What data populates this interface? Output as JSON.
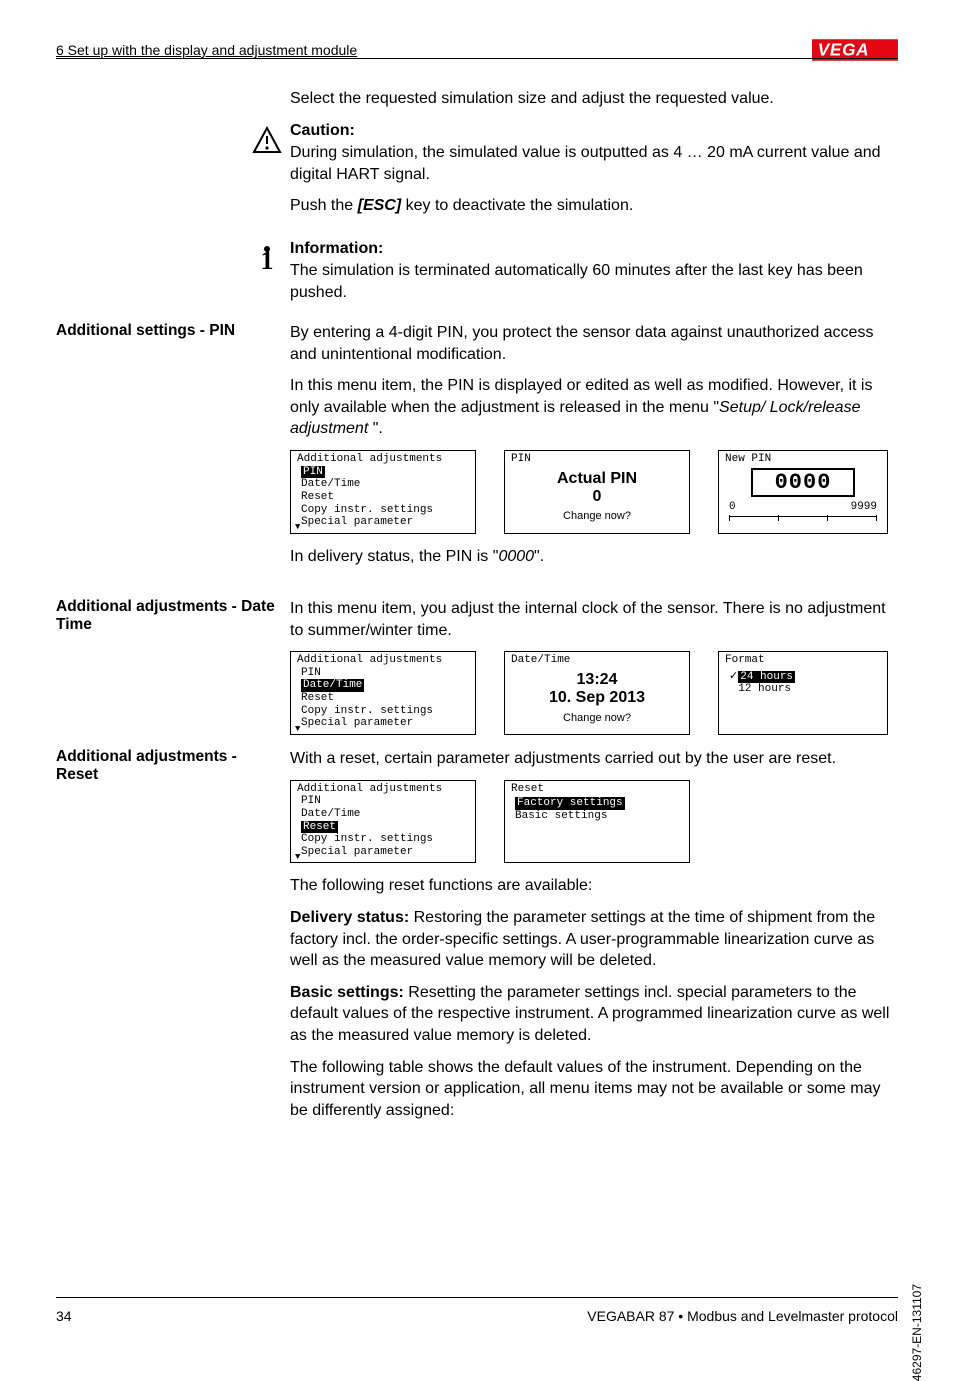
{
  "header": {
    "section": "6 Set up with the display and adjustment module",
    "logo_text": "VEGA"
  },
  "p_select": "Select the requested simulation size and adjust the requested value.",
  "caution": {
    "heading": "Caution:",
    "body1": "During simulation, the simulated value is outputted as 4 … 20 mA current value and digital HART signal.",
    "body2_pre": "Push the ",
    "body2_key": "[ESC]",
    "body2_post": " key to deactivate the simulation."
  },
  "info": {
    "heading": "Information:",
    "body": "The simulation is terminated automatically 60 minutes after the last key has been pushed."
  },
  "pin": {
    "sidebar": "Additional settings - PIN",
    "p1": "By entering a 4-digit PIN, you protect the sensor data against unauthorized access and unintentional modification.",
    "p2_pre": "In this menu item, the PIN is displayed or edited as well as modified. However, it is only available when the adjustment is released in the menu \"",
    "p2_em": "Setup/ Lock/release adjustment",
    "p2_post": " \".",
    "lcd1": {
      "title": "Additional adjustments",
      "items": [
        "PIN",
        "Date/Time",
        "Reset",
        "Copy instr. settings",
        "Special parameter"
      ],
      "highlight_index": 0
    },
    "lcd2": {
      "title": "PIN",
      "line1": "Actual PIN",
      "line2": "0",
      "line3": "Change now?"
    },
    "lcd3": {
      "title": "New PIN",
      "box": "0000",
      "left": "0",
      "right": "9999"
    },
    "delivery_pre": "In delivery status, the PIN is \"",
    "delivery_em": "0000",
    "delivery_post": "\"."
  },
  "datetime": {
    "sidebar": "Additional adjustments - Date Time",
    "p1": "In this menu item, you adjust the internal clock of the sensor. There is no adjustment to summer/winter time.",
    "lcd1": {
      "title": "Additional adjustments",
      "items": [
        "PIN",
        "Date/Time",
        "Reset",
        "Copy instr. settings",
        "Special parameter"
      ],
      "highlight_index": 1
    },
    "lcd2": {
      "title": "Date/Time",
      "line1": "13:24",
      "line2": "10. Sep 2013",
      "line3": "Change now?"
    },
    "lcd3": {
      "title": "Format",
      "items": [
        "24 hours",
        "12 hours"
      ],
      "highlight_index": 0
    }
  },
  "reset": {
    "sidebar": "Additional adjustments - Reset",
    "p1": "With a reset, certain parameter adjustments carried out by the user are reset.",
    "lcd1": {
      "title": "Additional adjustments",
      "items": [
        "PIN",
        "Date/Time",
        "Reset",
        "Copy instr. settings",
        "Special parameter"
      ],
      "highlight_index": 2
    },
    "lcd2": {
      "title": "Reset",
      "items": [
        "Factory settings",
        "Basic settings"
      ],
      "highlight_index": 0
    },
    "p_following": "The following reset functions are available:",
    "delivery_heading": "Delivery status:",
    "delivery_body": " Restoring the parameter settings at the time of shipment from the factory incl. the order-specific settings. A user-programmable linearization curve as well as the measured value memory will be deleted.",
    "basic_heading": "Basic settings:",
    "basic_body": " Resetting the parameter settings incl. special parameters to the default values of the respective instrument. A programmed linearization curve as well as the measured value memory is deleted.",
    "table_intro": "The following table shows the default values of the instrument. Depending on the instrument version or application, all menu items may not be available or some may be differently assigned:"
  },
  "footer": {
    "page": "34",
    "product": "VEGABAR 87 • Modbus and Levelmaster protocol",
    "docid": "46297-EN-131107"
  }
}
